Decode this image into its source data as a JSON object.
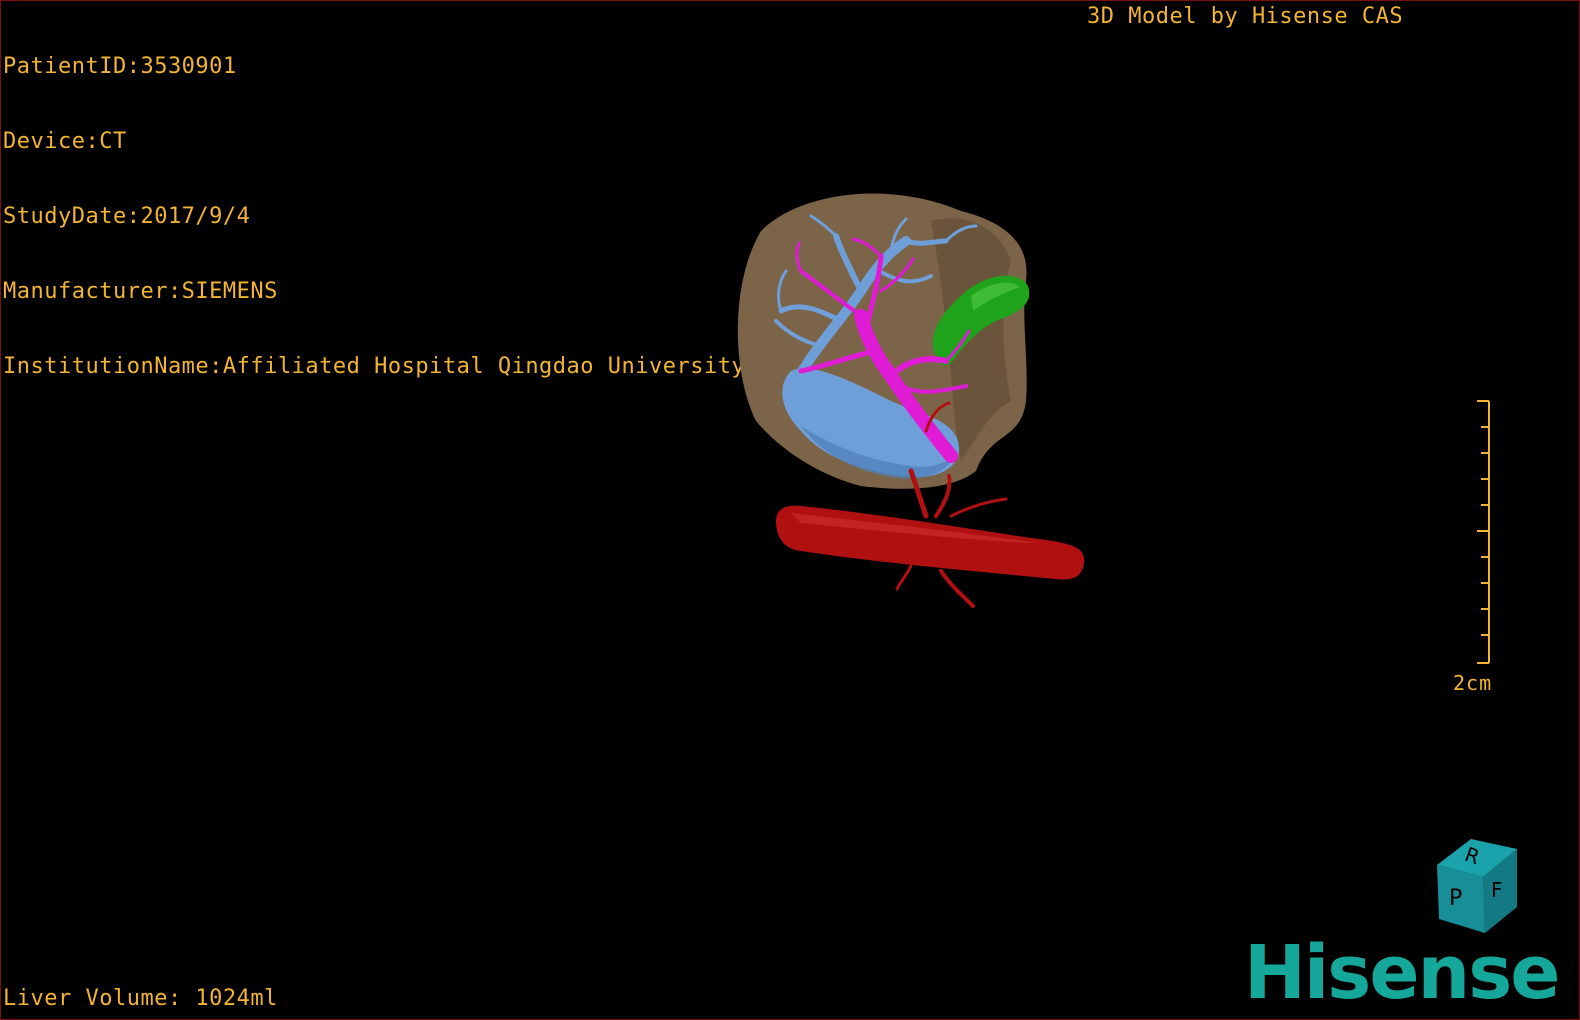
{
  "header": {
    "patient_id": "PatientID:3530901",
    "device": "Device:CT",
    "study_date": "StudyDate:2017/9/4",
    "manufacturer": "Manufacturer:SIEMENS",
    "institution": "InstitutionName:Affiliated Hospital Qingdao University-C"
  },
  "credit": "3D Model by Hisense CAS",
  "footer": {
    "liver_volume": "Liver Volume: 1024ml"
  },
  "scale": {
    "label": "2cm"
  },
  "orientation_cube": {
    "face_letters": [
      "R",
      "F",
      "P"
    ],
    "color": "#17808a"
  },
  "logo": {
    "text": "Hisense",
    "color": "#16a79b"
  },
  "colors": {
    "overlay_text": "#f2b431",
    "liver": "#7c6448",
    "hepatic_vein": "#6f9fd8",
    "portal_vein": "#e01bd6",
    "gallbladder": "#1fa31a",
    "artery": "#b01010",
    "border": "#7a1010"
  }
}
